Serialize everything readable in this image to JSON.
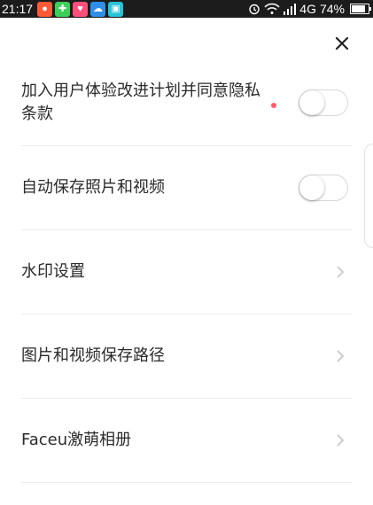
{
  "status_bar": {
    "time": "21:17",
    "network": "4G",
    "battery": "74%",
    "app_icon_colors": [
      "#ff5a36",
      "#3ecf5a",
      "#ff4f7a",
      "#2f8fe8",
      "#27c3d8"
    ]
  },
  "settings": {
    "items": [
      {
        "label": "加入用户体验改进计划并同意隐私条款",
        "control": "toggle",
        "on": false,
        "badge": true
      },
      {
        "label": "自动保存照片和视频",
        "control": "toggle",
        "on": false
      },
      {
        "label": "水印设置",
        "control": "chevron"
      },
      {
        "label": "图片和视频保存路径",
        "control": "chevron"
      },
      {
        "label": "Faceu激萌相册",
        "control": "chevron"
      }
    ]
  },
  "colors": {
    "badge": "#ff5d6c",
    "divider": "#ececec"
  }
}
